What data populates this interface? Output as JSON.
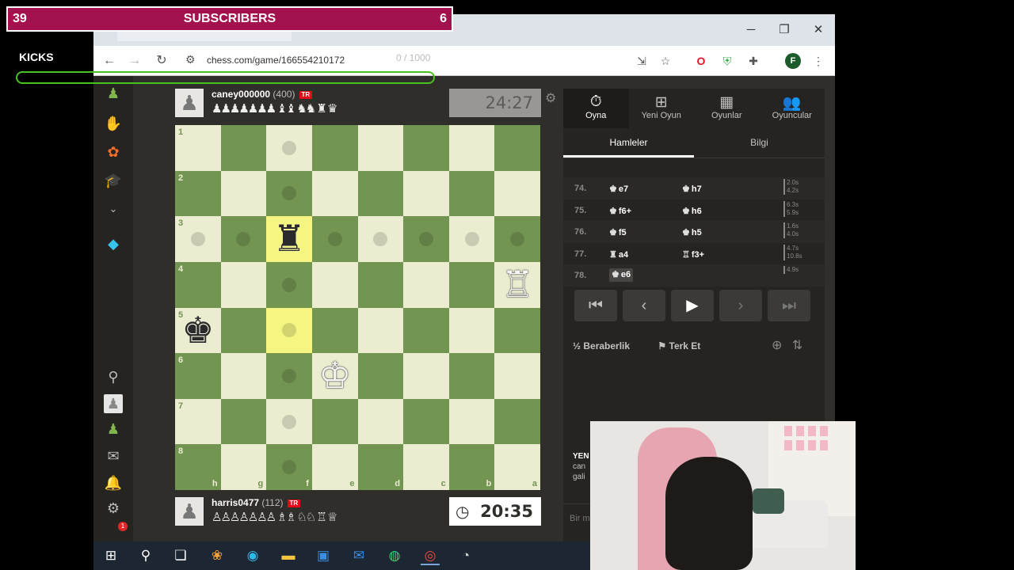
{
  "overlay": {
    "subscribers_left": "39",
    "subscribers_label": "SUBSCRIBERS",
    "subscribers_right": "6",
    "kicks_label": "KICKS",
    "kicks_count": "0 / 1000"
  },
  "browser": {
    "url": "chess.com/game/166554210172",
    "profile_initial": "F"
  },
  "top_player": {
    "name": "caney000000",
    "rating": "(400)",
    "flag": "TR",
    "captured": "♟♟♟♟♟♟♟ ♝♝ ♞♞ ♜ ♛",
    "clock": "24:27"
  },
  "bottom_player": {
    "name": "harris0477",
    "rating": "(112)",
    "flag": "TR",
    "captured": "♙♙♙♙♙♙♙ ♗♗ ♘♘ ♖ ♕",
    "clock": "20:35"
  },
  "board": {
    "ranks": [
      "1",
      "2",
      "3",
      "4",
      "5",
      "6",
      "7",
      "8"
    ],
    "files": [
      "h",
      "g",
      "f",
      "e",
      "d",
      "c",
      "b",
      "a"
    ]
  },
  "panel": {
    "tabs": [
      {
        "icon": "⏱",
        "label": "Oyna"
      },
      {
        "icon": "⊞",
        "label": "Yeni Oyun"
      },
      {
        "icon": "▦",
        "label": "Oyunlar"
      },
      {
        "icon": "👥",
        "label": "Oyuncular"
      }
    ],
    "subtabs": [
      "Hamleler",
      "Bilgi"
    ],
    "moves": [
      {
        "num": "74.",
        "wp": "♚",
        "w": "e7",
        "bp": "♚",
        "b": "h7",
        "t1": "2.0s",
        "t2": "4.2s"
      },
      {
        "num": "75.",
        "wp": "♚",
        "w": "f6+",
        "bp": "♚",
        "b": "h6",
        "t1": "6.3s",
        "t2": "5.9s"
      },
      {
        "num": "76.",
        "wp": "♚",
        "w": "f5",
        "bp": "♚",
        "b": "h5",
        "t1": "1.6s",
        "t2": "4.0s"
      },
      {
        "num": "77.",
        "wp": "♜",
        "w": "a4",
        "bp": "♖",
        "b": "f3+",
        "t1": "4.7s",
        "t2": "10.8s"
      },
      {
        "num": "78.",
        "wp": "♚",
        "w": "e6",
        "bp": "",
        "b": "",
        "t1": "4.9s",
        "t2": ""
      }
    ],
    "draw_label": "Beraberlik",
    "draw_icon": "½",
    "resign_label": "Terk Et",
    "chat_fragment_1": "YEN",
    "chat_fragment_2": "can",
    "chat_fragment_3": "gali",
    "chat_placeholder": "Bir m"
  }
}
